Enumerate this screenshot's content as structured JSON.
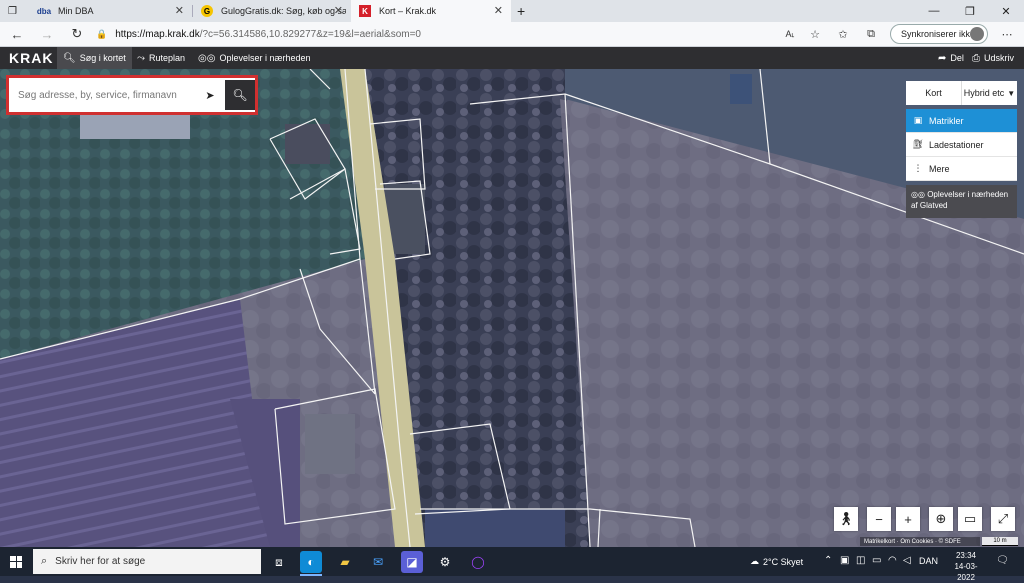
{
  "browser": {
    "tabs": [
      {
        "label": "Min DBA",
        "favicon": "dba",
        "active": false
      },
      {
        "label": "GulogGratis.dk: Søg, køb og sælg",
        "favicon": "G",
        "active": false
      },
      {
        "label": "Kort – Krak.dk",
        "favicon": "K",
        "active": true
      }
    ],
    "new_tab": "+",
    "url_domain": "https://map.krak.dk",
    "url_rest": "/?c=56.314586,10.829277&z=19&l=aerial&som=0",
    "sync_label": "Synkroniserer ikke"
  },
  "krak": {
    "logo": "KRAK",
    "nav": [
      {
        "label": "Søg i kortet",
        "icon": "search-icon"
      },
      {
        "label": "Ruteplan",
        "icon": "route-icon"
      },
      {
        "label": "Oplevelser i nærheden",
        "icon": "binoculars-icon"
      }
    ],
    "share_label": "Del",
    "print_label": "Udskriv"
  },
  "search": {
    "placeholder": "Søg adresse, by, service, firmanavn"
  },
  "layers": {
    "map_type": [
      "Kort",
      "Hybrid etc"
    ],
    "items": [
      {
        "label": "Matrikler",
        "selected": true
      },
      {
        "label": "Ladestationer",
        "selected": false
      },
      {
        "label": "Mere",
        "selected": false
      }
    ],
    "experience_box": "Oplevelser i nærheden af Glatved"
  },
  "map_footer": {
    "attribution": "Matrikelkort · Om Cookies · © SDFE",
    "scale": "10 m"
  },
  "taskbar": {
    "search_placeholder": "Skriv her for at søge",
    "weather": "2°C  Skyet",
    "language": "DAN",
    "time": "23:34",
    "date": "14-03-2022"
  },
  "colors": {
    "krak_header": "#2e2e31",
    "selected_layer": "#1e90d6",
    "search_border": "#d03030"
  }
}
